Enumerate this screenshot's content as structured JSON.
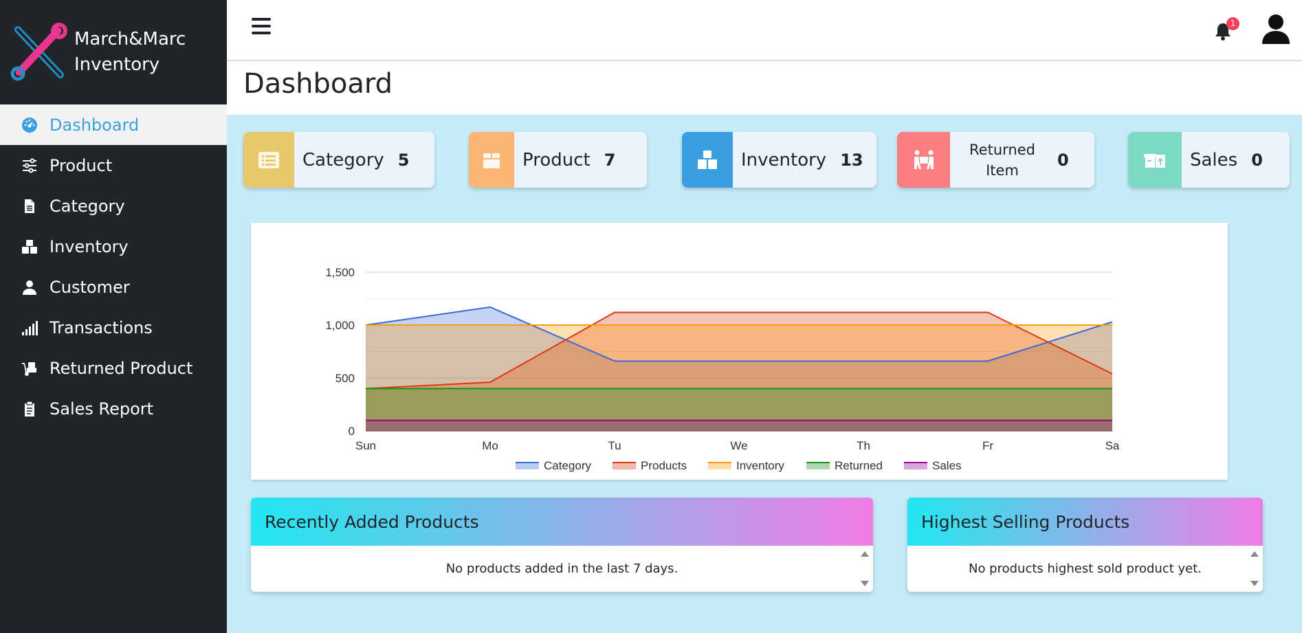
{
  "brand": {
    "line1": "March&Marc",
    "line2": "Inventory"
  },
  "sidebar": {
    "items": [
      {
        "label": "Dashboard",
        "icon": "gauge-icon"
      },
      {
        "label": "Product",
        "icon": "sliders-icon"
      },
      {
        "label": "Category",
        "icon": "file-icon"
      },
      {
        "label": "Inventory",
        "icon": "boxes-icon"
      },
      {
        "label": "Customer",
        "icon": "user-icon"
      },
      {
        "label": "Transactions",
        "icon": "signal-bars-icon"
      },
      {
        "label": "Returned Product",
        "icon": "dolly-icon"
      },
      {
        "label": "Sales Report",
        "icon": "clipboard-icon"
      }
    ]
  },
  "topbar": {
    "notification_count": "1"
  },
  "page": {
    "title": "Dashboard"
  },
  "stats": [
    {
      "label": "Category",
      "value": "5",
      "color": "#e7c96c",
      "icon": "list-icon"
    },
    {
      "label": "Product",
      "value": "7",
      "color": "#f9b573",
      "icon": "box-icon"
    },
    {
      "label": "Inventory",
      "value": "13",
      "color": "#3a9fe0",
      "icon": "boxes-icon"
    },
    {
      "label": "Returned Item",
      "value": "0",
      "color": "#fd7e7e",
      "icon": "people-carry-icon"
    },
    {
      "label": "Sales",
      "value": "0",
      "color": "#7dd9c4",
      "icon": "box-arrow-icon"
    }
  ],
  "chart_data": {
    "type": "area",
    "categories": [
      "Sun",
      "Mo",
      "Tu",
      "We",
      "Th",
      "Fr",
      "Sa"
    ],
    "series": [
      {
        "name": "Category",
        "color": "#3b6ad6",
        "values": [
          1000,
          1170,
          660,
          660,
          660,
          660,
          1030
        ]
      },
      {
        "name": "Products",
        "color": "#dc3912",
        "values": [
          400,
          460,
          1120,
          1120,
          1120,
          1120,
          540
        ]
      },
      {
        "name": "Inventory",
        "color": "#ff9900",
        "values": [
          1000,
          1000,
          1000,
          1000,
          1000,
          1000,
          1000
        ]
      },
      {
        "name": "Returned",
        "color": "#109618",
        "values": [
          400,
          400,
          400,
          400,
          400,
          400,
          400
        ]
      },
      {
        "name": "Sales",
        "color": "#990099",
        "values": [
          100,
          100,
          100,
          100,
          100,
          100,
          100
        ]
      }
    ],
    "yticks": [
      "0",
      "500",
      "1,000",
      "1,500"
    ],
    "ylim": [
      0,
      1500
    ],
    "legend": "bottom",
    "grid": true
  },
  "panels": {
    "recent": {
      "title": "Recently Added Products",
      "message": "No products added in the last 7 days."
    },
    "highest": {
      "title": "Highest Selling Products",
      "message": "No products highest sold product yet."
    }
  }
}
